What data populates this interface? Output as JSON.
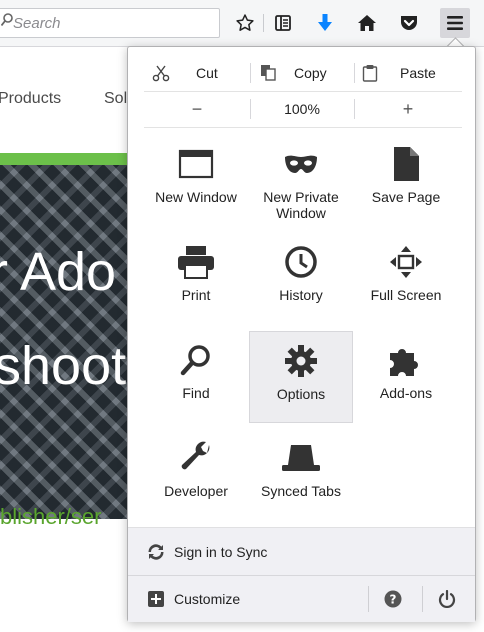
{
  "toolbar": {
    "search_placeholder": "Search",
    "icons": [
      "star-icon",
      "reading-list-icon",
      "downloads-icon",
      "home-icon",
      "pocket-icon",
      "menu-icon"
    ],
    "download_color": "#0a84ff"
  },
  "page": {
    "nav": [
      "Products",
      "Sol"
    ],
    "hero_line1": "r Ado",
    "hero_line2": "shoot",
    "link": "blisher/ser",
    "accent": "#6cc04a"
  },
  "menu": {
    "edit": {
      "cut": "Cut",
      "copy": "Copy",
      "paste": "Paste"
    },
    "zoom": {
      "minus": "−",
      "value": "100%",
      "plus": "+"
    },
    "items": [
      {
        "label": "New Window",
        "icon": "new-window-icon"
      },
      {
        "label": "New Private Window",
        "icon": "private-mask-icon"
      },
      {
        "label": "Save Page",
        "icon": "save-page-icon"
      },
      {
        "label": "Print",
        "icon": "printer-icon"
      },
      {
        "label": "History",
        "icon": "history-clock-icon"
      },
      {
        "label": "Full Screen",
        "icon": "fullscreen-icon"
      },
      {
        "label": "Find",
        "icon": "magnifier-icon"
      },
      {
        "label": "Options",
        "icon": "gear-icon"
      },
      {
        "label": "Add-ons",
        "icon": "puzzle-icon"
      },
      {
        "label": "Developer",
        "icon": "wrench-icon"
      },
      {
        "label": "Synced Tabs",
        "icon": "synced-tabs-icon"
      }
    ],
    "sync_label": "Sign in to Sync",
    "customize_label": "Customize"
  }
}
